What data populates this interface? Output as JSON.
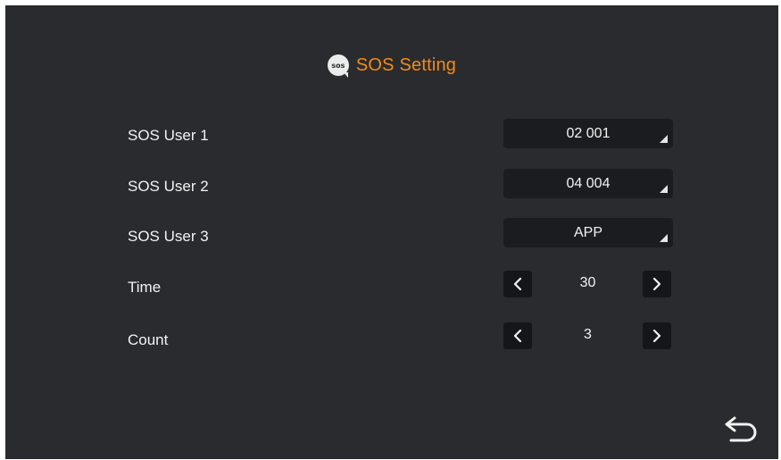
{
  "header": {
    "icon": "sos-icon",
    "icon_text": "sos",
    "title": "SOS Setting"
  },
  "rows": [
    {
      "label": "SOS User 1",
      "type": "dropdown",
      "value": "02 001"
    },
    {
      "label": "SOS User 2",
      "type": "dropdown",
      "value": "04 004"
    },
    {
      "label": "SOS User 3",
      "type": "dropdown",
      "value": "APP"
    },
    {
      "label": "Time",
      "type": "stepper",
      "value": "30"
    },
    {
      "label": "Count",
      "type": "stepper",
      "value": "3"
    }
  ],
  "footer": {
    "back_icon": "back-arrow-icon"
  },
  "colors": {
    "background": "#2a2b2f",
    "accent": "#f28b1a",
    "control_bg": "#1b1c1f",
    "text": "#f2f2f2"
  }
}
